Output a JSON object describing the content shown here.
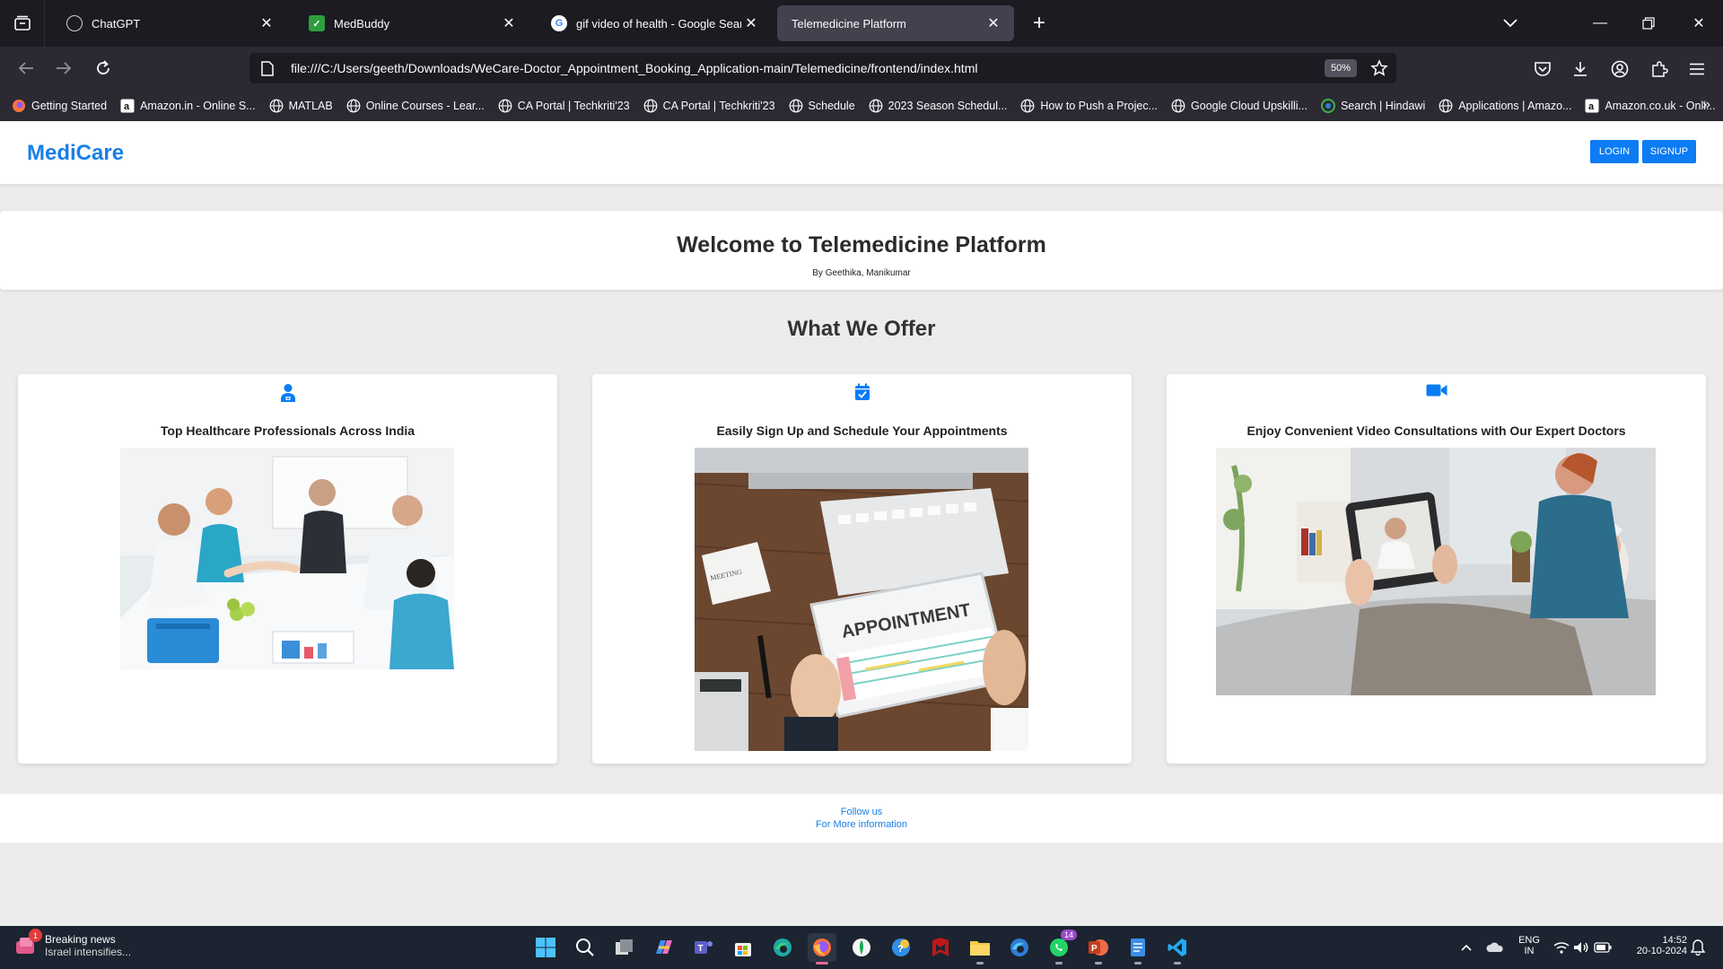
{
  "browser": {
    "tabs": [
      {
        "title": "ChatGPT",
        "favicon": "chatgpt-icon"
      },
      {
        "title": "MedBuddy",
        "favicon": "medbuddy-icon"
      },
      {
        "title": "gif video of health - Google Search",
        "favicon": "google-icon"
      },
      {
        "title": "Telemedicine Platform",
        "favicon": "",
        "active": true
      }
    ],
    "url": "file:///C:/Users/geeth/Downloads/WeCare-Doctor_Appointment_Booking_Application-main/Telemedicine/frontend/index.html",
    "zoom": "50%",
    "bookmarks": [
      {
        "label": "Getting Started",
        "icon": "firefox-icon"
      },
      {
        "label": "Amazon.in - Online S...",
        "icon": "amazon-icon"
      },
      {
        "label": "MATLAB",
        "icon": "globe-icon"
      },
      {
        "label": "Online Courses - Lear...",
        "icon": "globe-icon"
      },
      {
        "label": "CA Portal | Techkriti'23",
        "icon": "globe-icon"
      },
      {
        "label": "CA Portal | Techkriti'23",
        "icon": "globe-icon"
      },
      {
        "label": "Schedule",
        "icon": "globe-icon"
      },
      {
        "label": "2023 Season Schedul...",
        "icon": "globe-icon"
      },
      {
        "label": "How to Push a Projec...",
        "icon": "globe-icon"
      },
      {
        "label": "Google Cloud Upskilli...",
        "icon": "globe-icon"
      },
      {
        "label": "Search | Hindawi",
        "icon": "hindawi-icon"
      },
      {
        "label": "Applications | Amazo...",
        "icon": "globe-icon"
      },
      {
        "label": "Amazon.co.uk - Onli...",
        "icon": "amazon-icon"
      }
    ]
  },
  "site": {
    "brand": "MediCare",
    "login": "LOGIN",
    "signup": "SIGNUP",
    "welcome_title": "Welcome to Telemedicine Platform",
    "byline": "By Geethika, Manikumar",
    "offer_title": "What We Offer",
    "cards": [
      {
        "title": "Top Healthcare Professionals Across India",
        "icon": "user-doctor-icon"
      },
      {
        "title": "Easily Sign Up and Schedule Your Appointments",
        "icon": "calendar-check-icon"
      },
      {
        "title": "Enjoy Convenient Video Consultations with Our Expert Doctors",
        "icon": "video-icon"
      }
    ],
    "appointment_text": "APPOINTMENT",
    "footer_line1": "Follow us",
    "footer_line2": "For More information",
    "accent": "#0b7cf3"
  },
  "taskbar": {
    "news_title": "Breaking news",
    "news_sub": "Israel intensifies...",
    "news_badge": "1",
    "whatsapp_badge": "14",
    "lang1": "ENG",
    "lang2": "IN",
    "time": "14:52",
    "date": "20-10-2024"
  }
}
